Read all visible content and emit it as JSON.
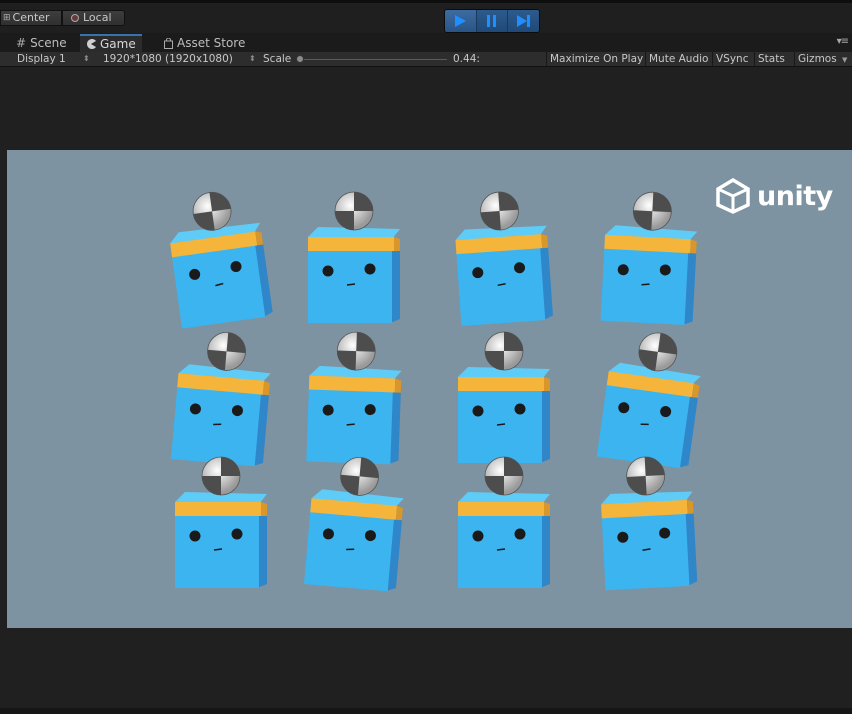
{
  "toolbar": {
    "pivot_center_label": "Center",
    "pivot_local_label": "Local",
    "controls": [
      "play-icon",
      "pause-icon",
      "step-icon"
    ],
    "accent_color": "#3a72b0"
  },
  "tabs": [
    {
      "label": "Scene",
      "icon": "grid-icon"
    },
    {
      "label": "Game",
      "icon": "pacman-icon",
      "active": true
    },
    {
      "label": "Asset Store",
      "icon": "bag-icon"
    }
  ],
  "game_bar": {
    "display": "Display 1",
    "resolution": "1920*1080 (1920x1080)",
    "scale_label": "Scale",
    "scale_value": "0.44:",
    "maximize": "Maximize On Play",
    "mute": "Mute Audio",
    "vsync": "VSync",
    "stats": "Stats",
    "gizmos": "Gizmos"
  },
  "game_view": {
    "background_color": "#7d93a1",
    "logo_text": "unity",
    "characters": [
      {
        "row": 1,
        "col": 1
      },
      {
        "row": 1,
        "col": 2
      },
      {
        "row": 1,
        "col": 3
      },
      {
        "row": 1,
        "col": 4
      },
      {
        "row": 2,
        "col": 1
      },
      {
        "row": 2,
        "col": 2
      },
      {
        "row": 2,
        "col": 3
      },
      {
        "row": 2,
        "col": 4
      },
      {
        "row": 3,
        "col": 1
      },
      {
        "row": 3,
        "col": 2
      },
      {
        "row": 3,
        "col": 3
      },
      {
        "row": 3,
        "col": 4
      }
    ],
    "cube_color": "#3cb4f0",
    "band_color": "#f5b43a"
  }
}
